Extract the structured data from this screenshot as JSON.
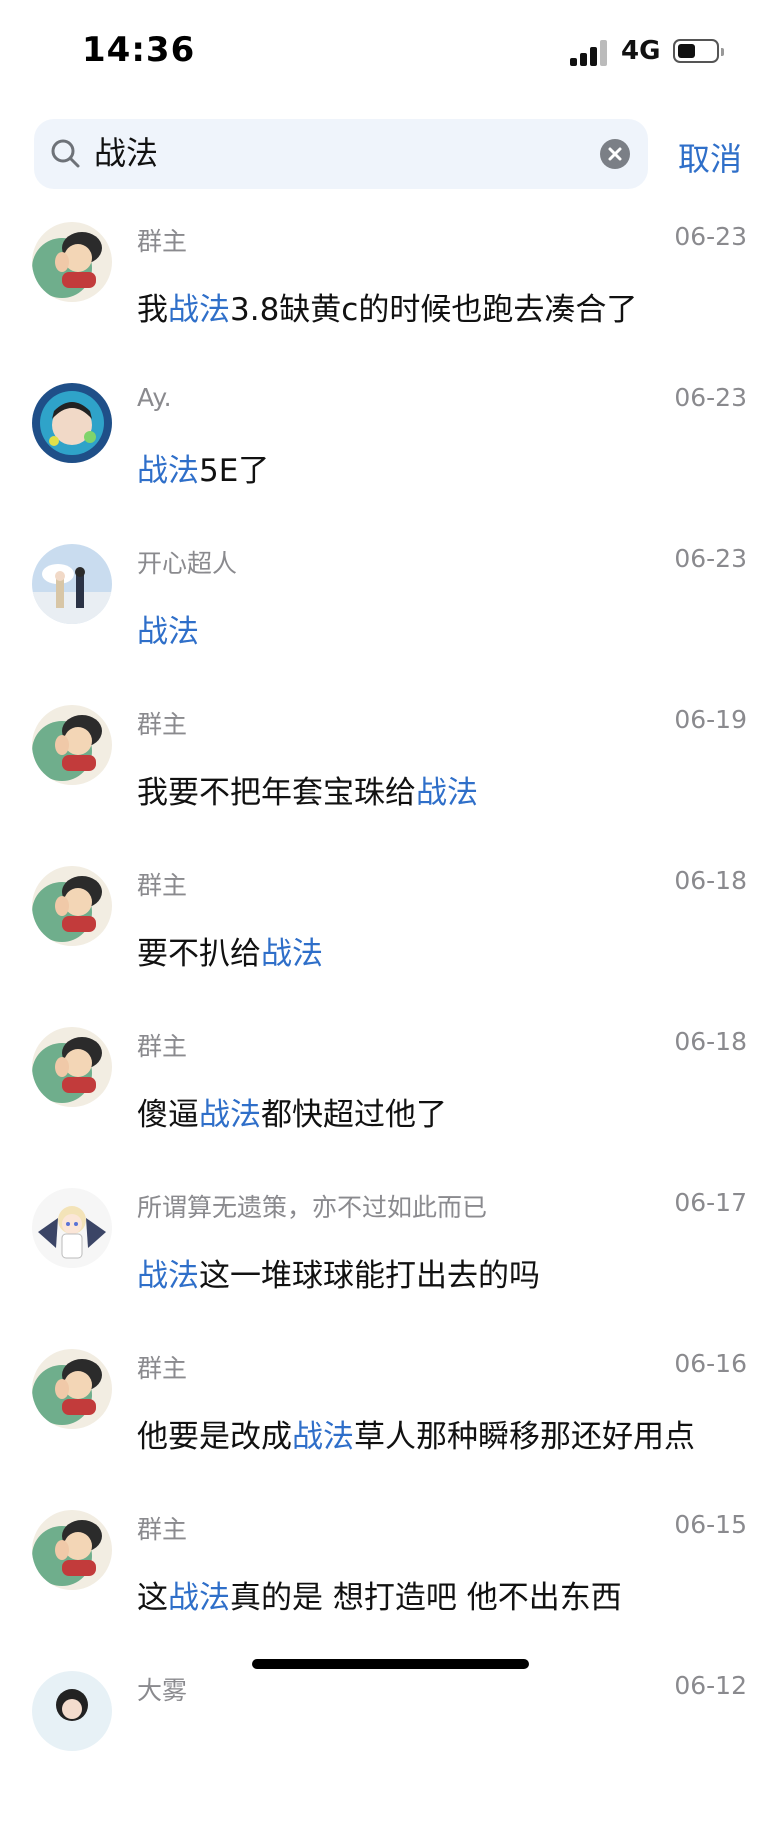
{
  "status_bar": {
    "time": "14:36",
    "network": "4G",
    "battery_level": 0.35
  },
  "search": {
    "query": "战法",
    "cancel_label": "取消"
  },
  "colors": {
    "highlight": "#2f6fc9",
    "muted": "#8a8a8e",
    "search_bg": "#eff4fb"
  },
  "results": [
    {
      "sender": "群主",
      "date": "06-23",
      "avatar": "cartoon-avatar",
      "pre": "我",
      "hl": "战法",
      "post": "3.8缺黄c的时候也跑去凑合了"
    },
    {
      "sender": "Ay.",
      "date": "06-23",
      "avatar": "anime-hooded-avatar",
      "pre": "",
      "hl": "战法",
      "post": "5E了"
    },
    {
      "sender": "开心超人",
      "date": "06-23",
      "avatar": "sky-couple-avatar",
      "pre": "",
      "hl": "战法",
      "post": ""
    },
    {
      "sender": "群主",
      "date": "06-19",
      "avatar": "cartoon-avatar",
      "pre": "我要不把年套宝珠给",
      "hl": "战法",
      "post": ""
    },
    {
      "sender": "群主",
      "date": "06-18",
      "avatar": "cartoon-avatar",
      "pre": "要不扒给",
      "hl": "战法",
      "post": ""
    },
    {
      "sender": "群主",
      "date": "06-18",
      "avatar": "cartoon-avatar",
      "pre": "傻逼",
      "hl": "战法",
      "post": "都快超过他了"
    },
    {
      "sender": "所谓算无遗策，亦不过如此而已",
      "date": "06-17",
      "avatar": "anime-winged-avatar",
      "pre": "",
      "hl": "战法",
      "post": "这一堆球球能打出去的吗"
    },
    {
      "sender": "群主",
      "date": "06-16",
      "avatar": "cartoon-avatar",
      "pre": "他要是改成",
      "hl": "战法",
      "post": "草人那种瞬移那还好用点"
    },
    {
      "sender": "群主",
      "date": "06-15",
      "avatar": "cartoon-avatar",
      "pre": "这",
      "hl": "战法",
      "post": "真的是 想打造吧 他不出东西"
    },
    {
      "sender": "大雾",
      "date": "06-12",
      "avatar": "anime-avatar",
      "pre": "",
      "hl": "",
      "post": ""
    }
  ]
}
